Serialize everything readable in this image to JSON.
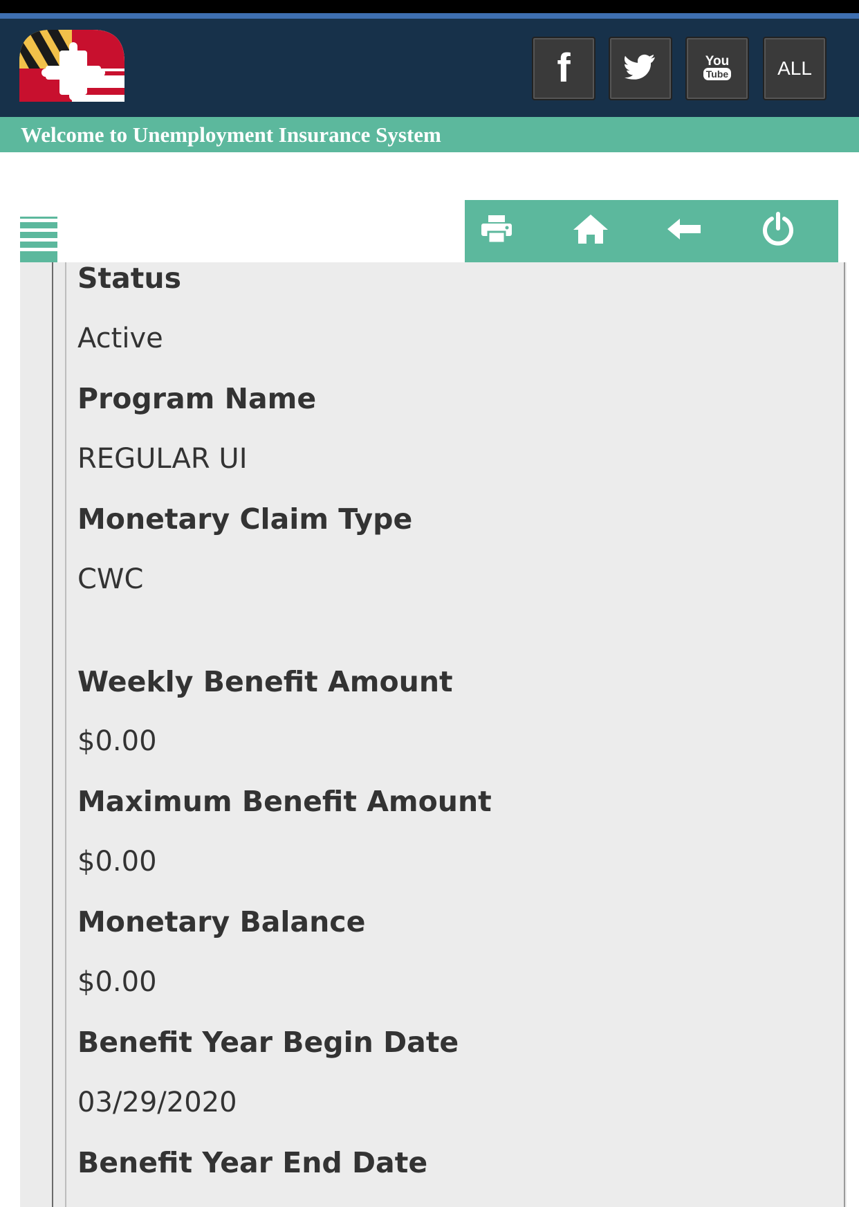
{
  "header": {
    "logo_alt": "Maryland flag logo",
    "social": [
      {
        "icon": "facebook-icon",
        "label": "f"
      },
      {
        "icon": "twitter-icon",
        "label": ""
      },
      {
        "icon": "youtube-icon",
        "label": "You Tube"
      },
      {
        "icon": "all-icon",
        "label": "ALL"
      }
    ]
  },
  "welcome": {
    "text": "Welcome to Unemployment Insurance System"
  },
  "toolbar": {
    "items": [
      {
        "icon": "print-icon"
      },
      {
        "icon": "home-icon"
      },
      {
        "icon": "back-arrow-icon"
      },
      {
        "icon": "power-icon"
      }
    ]
  },
  "colors": {
    "header_bg": "#17314a",
    "accent_green": "#5cb89d",
    "panel_bg": "#ececec",
    "text": "#333333"
  },
  "claim": {
    "fields": [
      {
        "label": "Status",
        "value": "Active"
      },
      {
        "label": "Program Name",
        "value": "REGULAR UI"
      },
      {
        "label": "Monetary Claim Type",
        "value": "CWC"
      },
      {
        "label": "Weekly Benefit Amount",
        "value": "$0.00"
      },
      {
        "label": "Maximum Benefit Amount",
        "value": "$0.00"
      },
      {
        "label": "Monetary Balance",
        "value": "$0.00"
      },
      {
        "label": "Benefit Year Begin Date",
        "value": "03/29/2020"
      },
      {
        "label": "Benefit Year End Date",
        "value": ""
      }
    ]
  }
}
